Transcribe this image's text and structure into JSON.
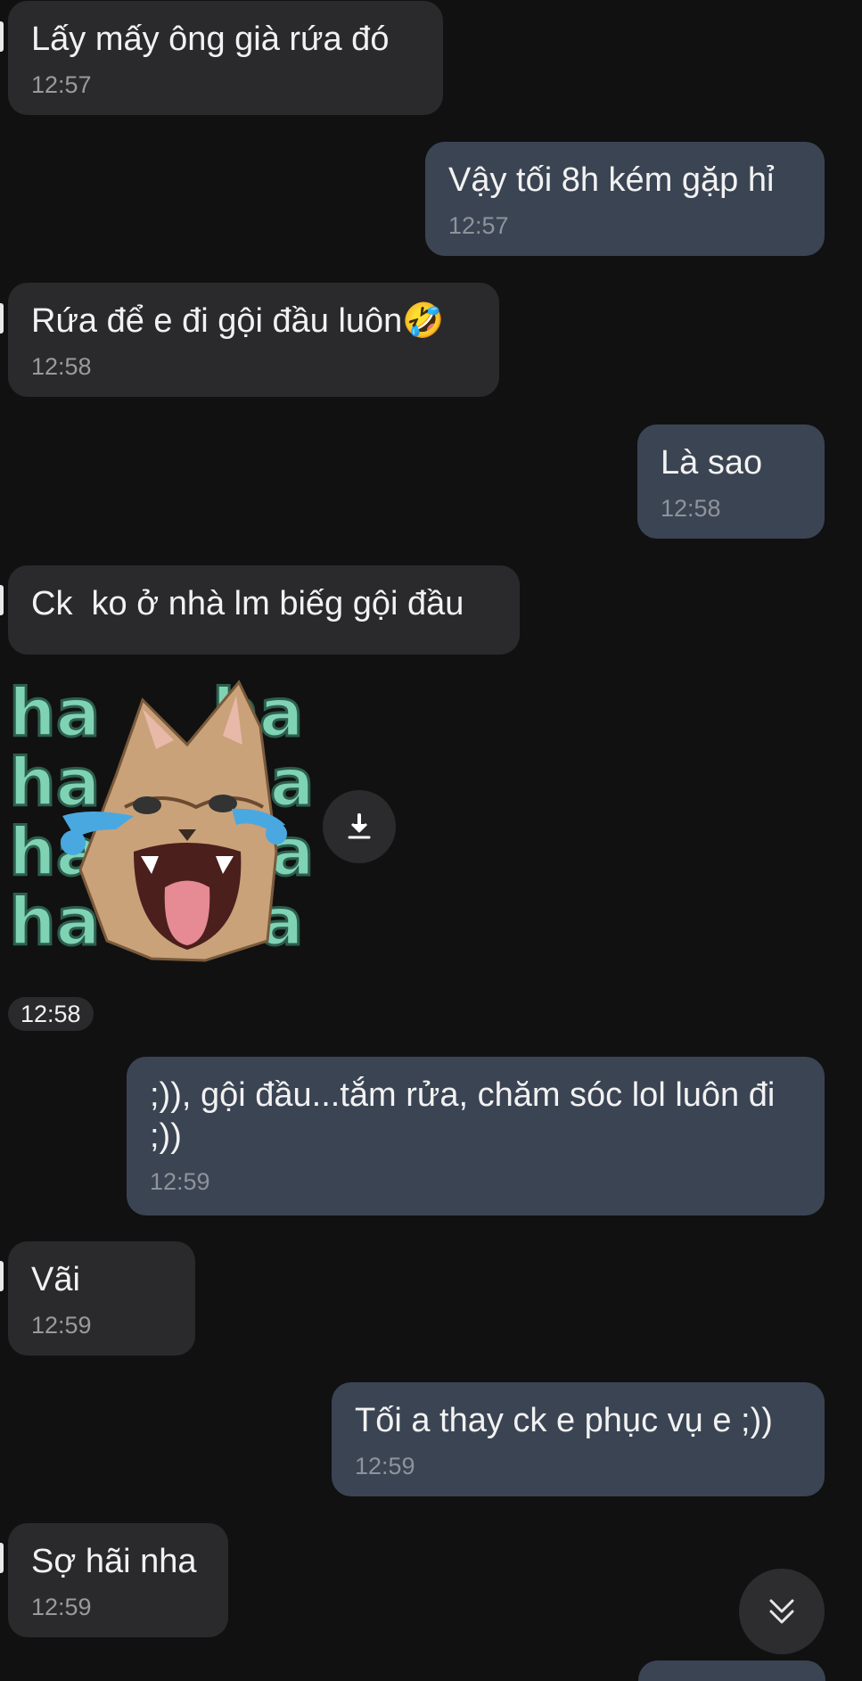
{
  "messages": [
    {
      "dir": "in",
      "text": "Lấy mấy ông già rứa đó",
      "time": "12:57"
    },
    {
      "dir": "out",
      "text": "Vậy tối 8h kém gặp hỉ",
      "time": "12:57"
    },
    {
      "dir": "in",
      "text": "Rứa để e đi gội đầu luôn🤣",
      "time": "12:58"
    },
    {
      "dir": "out",
      "text": "Là sao",
      "time": "12:58"
    },
    {
      "dir": "in",
      "text": "Ck  ko ở nhà lm biếg gội đầu"
    },
    {
      "dir": "out",
      "text": ";)), gội đầu...tắm rửa, chăm sóc lol luôn đi ;))",
      "time": "12:59"
    },
    {
      "dir": "in",
      "text": "Vãi",
      "time": "12:59"
    },
    {
      "dir": "out",
      "text": "Tối a thay ck e phục vụ e ;))",
      "time": "12:59"
    },
    {
      "dir": "in",
      "text": "Sợ hãi nha",
      "time": "12:59"
    }
  ],
  "sticker": {
    "time": "12:58",
    "words": [
      "ha",
      "ha",
      "ha",
      "ha",
      "ha",
      "ha",
      "ha",
      "ha"
    ],
    "icon": "laughing-cat-sticker",
    "text_color": "#7fd3b4"
  },
  "icons": {
    "download": "download-icon",
    "scroll_down": "double-chevron-down-icon"
  },
  "colors": {
    "background": "#111111",
    "incoming_bubble": "#2a2a2c",
    "outgoing_bubble": "#3b4453",
    "text": "#f2f2f2",
    "time": "#8e939b"
  }
}
